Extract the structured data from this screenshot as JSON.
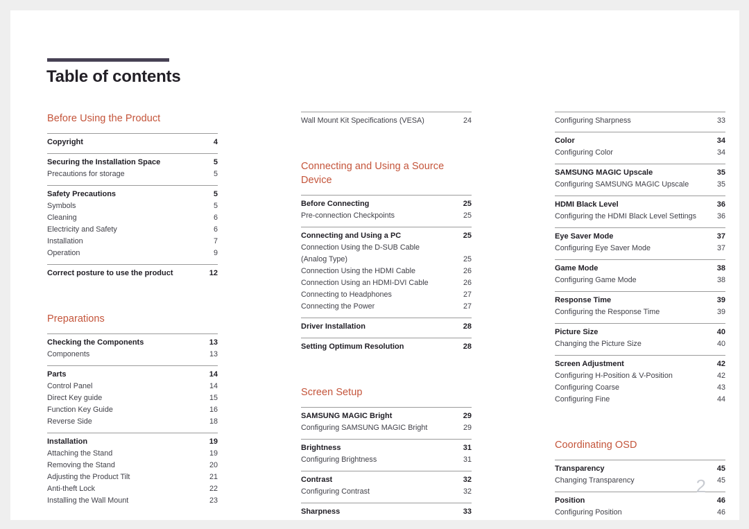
{
  "document": {
    "title": "Table of contents",
    "folio": "2",
    "accent_color": "#c4543a",
    "rule_color": "#474154"
  },
  "columns": [
    {
      "name": "column-1",
      "blocks": [
        {
          "type": "section-heading",
          "text": "Before Using the Product"
        },
        {
          "type": "group",
          "entries": [
            {
              "level": "head",
              "label": "Copyright",
              "page": "4"
            }
          ]
        },
        {
          "type": "group",
          "entries": [
            {
              "level": "head",
              "label": "Securing the Installation Space",
              "page": "5"
            },
            {
              "level": "sub",
              "label": "Precautions for storage",
              "page": "5"
            }
          ]
        },
        {
          "type": "group",
          "entries": [
            {
              "level": "head",
              "label": "Safety Precautions",
              "page": "5"
            },
            {
              "level": "sub",
              "label": "Symbols",
              "page": "5"
            },
            {
              "level": "sub",
              "label": "Cleaning",
              "page": "6"
            },
            {
              "level": "sub",
              "label": "Electricity and Safety",
              "page": "6"
            },
            {
              "level": "sub",
              "label": "Installation",
              "page": "7"
            },
            {
              "level": "sub",
              "label": "Operation",
              "page": "9"
            }
          ]
        },
        {
          "type": "group",
          "entries": [
            {
              "level": "head",
              "label": "Correct posture to use the product",
              "page": "12"
            }
          ]
        },
        {
          "type": "section-heading",
          "text": "Preparations"
        },
        {
          "type": "group",
          "entries": [
            {
              "level": "head",
              "label": "Checking the Components",
              "page": "13"
            },
            {
              "level": "sub",
              "label": "Components",
              "page": "13"
            }
          ]
        },
        {
          "type": "group",
          "entries": [
            {
              "level": "head",
              "label": "Parts",
              "page": "14"
            },
            {
              "level": "sub",
              "label": "Control Panel",
              "page": "14"
            },
            {
              "level": "sub",
              "label": "Direct Key guide",
              "page": "15"
            },
            {
              "level": "sub",
              "label": "Function Key Guide",
              "page": "16"
            },
            {
              "level": "sub",
              "label": "Reverse Side",
              "page": "18"
            }
          ]
        },
        {
          "type": "group",
          "entries": [
            {
              "level": "head",
              "label": "Installation",
              "page": "19"
            },
            {
              "level": "sub",
              "label": "Attaching the Stand",
              "page": "19"
            },
            {
              "level": "sub",
              "label": "Removing the Stand",
              "page": "20"
            },
            {
              "level": "sub",
              "label": "Adjusting the Product Tilt",
              "page": "21"
            },
            {
              "level": "sub",
              "label": "Anti-theft Lock",
              "page": "22"
            },
            {
              "level": "sub",
              "label": "Installing the Wall Mount",
              "page": "23"
            }
          ]
        }
      ]
    },
    {
      "name": "column-2",
      "blocks": [
        {
          "type": "group",
          "entries": [
            {
              "level": "sub",
              "label": "Wall Mount Kit Specifications (VESA)",
              "page": "24"
            }
          ]
        },
        {
          "type": "section-heading",
          "text": "Connecting and Using a Source Device"
        },
        {
          "type": "group",
          "entries": [
            {
              "level": "head",
              "label": "Before Connecting",
              "page": "25"
            },
            {
              "level": "sub",
              "label": "Pre-connection Checkpoints",
              "page": "25"
            }
          ]
        },
        {
          "type": "group",
          "entries": [
            {
              "level": "head",
              "label": "Connecting and Using a PC",
              "page": "25"
            },
            {
              "level": "cont",
              "label": "Connection Using the D-SUB Cable",
              "page": ""
            },
            {
              "level": "sub",
              "label": "(Analog Type)",
              "page": "25"
            },
            {
              "level": "sub",
              "label": "Connection Using the HDMI Cable",
              "page": "26"
            },
            {
              "level": "sub",
              "label": "Connection Using an HDMI-DVI Cable",
              "page": "26"
            },
            {
              "level": "sub",
              "label": "Connecting to Headphones",
              "page": "27"
            },
            {
              "level": "sub",
              "label": "Connecting the Power",
              "page": "27"
            }
          ]
        },
        {
          "type": "group",
          "entries": [
            {
              "level": "head",
              "label": "Driver Installation",
              "page": "28"
            }
          ]
        },
        {
          "type": "group",
          "entries": [
            {
              "level": "head",
              "label": "Setting Optimum Resolution",
              "page": "28"
            }
          ]
        },
        {
          "type": "section-heading",
          "text": "Screen Setup"
        },
        {
          "type": "group",
          "entries": [
            {
              "level": "head",
              "label": "SAMSUNG MAGIC Bright",
              "page": "29"
            },
            {
              "level": "sub",
              "label": "Configuring SAMSUNG MAGIC Bright",
              "page": "29"
            }
          ]
        },
        {
          "type": "group",
          "entries": [
            {
              "level": "head",
              "label": "Brightness",
              "page": "31"
            },
            {
              "level": "sub",
              "label": "Configuring Brightness",
              "page": "31"
            }
          ]
        },
        {
          "type": "group",
          "entries": [
            {
              "level": "head",
              "label": "Contrast",
              "page": "32"
            },
            {
              "level": "sub",
              "label": "Configuring Contrast",
              "page": "32"
            }
          ]
        },
        {
          "type": "group",
          "entries": [
            {
              "level": "head",
              "label": "Sharpness",
              "page": "33"
            }
          ]
        }
      ]
    },
    {
      "name": "column-3",
      "blocks": [
        {
          "type": "group",
          "entries": [
            {
              "level": "sub",
              "label": "Configuring Sharpness",
              "page": "33"
            }
          ]
        },
        {
          "type": "group",
          "entries": [
            {
              "level": "head",
              "label": "Color",
              "page": "34"
            },
            {
              "level": "sub",
              "label": "Configuring Color",
              "page": "34"
            }
          ]
        },
        {
          "type": "group",
          "entries": [
            {
              "level": "head",
              "label": "SAMSUNG MAGIC Upscale",
              "page": "35"
            },
            {
              "level": "sub",
              "label": "Configuring SAMSUNG MAGIC Upscale",
              "page": "35"
            }
          ]
        },
        {
          "type": "group",
          "entries": [
            {
              "level": "head",
              "label": "HDMI Black Level",
              "page": "36"
            },
            {
              "level": "sub",
              "label": "Configuring the HDMI Black Level Settings",
              "page": "36"
            }
          ]
        },
        {
          "type": "group",
          "entries": [
            {
              "level": "head",
              "label": "Eye Saver Mode",
              "page": "37"
            },
            {
              "level": "sub",
              "label": "Configuring Eye Saver Mode",
              "page": "37"
            }
          ]
        },
        {
          "type": "group",
          "entries": [
            {
              "level": "head",
              "label": "Game Mode",
              "page": "38"
            },
            {
              "level": "sub",
              "label": "Configuring Game Mode",
              "page": "38"
            }
          ]
        },
        {
          "type": "group",
          "entries": [
            {
              "level": "head",
              "label": "Response Time",
              "page": "39"
            },
            {
              "level": "sub",
              "label": "Configuring the Response Time",
              "page": "39"
            }
          ]
        },
        {
          "type": "group",
          "entries": [
            {
              "level": "head",
              "label": "Picture Size",
              "page": "40"
            },
            {
              "level": "sub",
              "label": "Changing the Picture Size",
              "page": "40"
            }
          ]
        },
        {
          "type": "group",
          "entries": [
            {
              "level": "head",
              "label": "Screen Adjustment",
              "page": "42"
            },
            {
              "level": "sub",
              "label": "Configuring H-Position & V-Position",
              "page": "42"
            },
            {
              "level": "sub",
              "label": "Configuring Coarse",
              "page": "43"
            },
            {
              "level": "sub",
              "label": "Configuring Fine",
              "page": "44"
            }
          ]
        },
        {
          "type": "section-heading",
          "text": "Coordinating OSD"
        },
        {
          "type": "group",
          "entries": [
            {
              "level": "head",
              "label": "Transparency",
              "page": "45"
            },
            {
              "level": "sub",
              "label": "Changing Transparency",
              "page": "45"
            }
          ]
        },
        {
          "type": "group",
          "entries": [
            {
              "level": "head",
              "label": "Position",
              "page": "46"
            },
            {
              "level": "sub",
              "label": "Configuring Position",
              "page": "46"
            }
          ]
        }
      ]
    }
  ]
}
